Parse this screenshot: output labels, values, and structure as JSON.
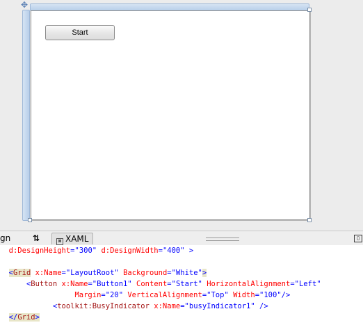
{
  "designer": {
    "start_button_label": "Start"
  },
  "tabs": {
    "design_label": "gn",
    "swap_glyph": "⇅",
    "xaml_label": "XAML"
  },
  "icons": {
    "move_handle": "move-icon",
    "swap": "swap-panes-icon",
    "xaml_tab": "xaml-icon",
    "collapse": "collapse-pane-icon"
  },
  "code": {
    "line1": {
      "a1": "d:DesignHeight",
      "eq1": "=",
      "v1": "\"300\"",
      "a2": "d:DesignWidth",
      "eq2": "=",
      "v2": "\"400\"",
      "close": ">"
    },
    "line3": {
      "open": "<",
      "elem": "Grid",
      "a1": "x:Name",
      "eq1": "=",
      "v1": "\"LayoutRoot\"",
      "a2": "Background",
      "eq2": "=",
      "v2": "\"White\"",
      "close": ">"
    },
    "line4": {
      "open": "<",
      "elem": "Button",
      "a1": "x:Name",
      "eq1": "=",
      "v1": "\"Button1\"",
      "a2": "Content",
      "eq2": "=",
      "v2": "\"Start\"",
      "a3": "HorizontalAlignment",
      "eq3": "=",
      "v3": "\"Left\""
    },
    "line5": {
      "a1": "Margin",
      "eq1": "=",
      "v1": "\"20\"",
      "a2": "VerticalAlignment",
      "eq2": "=",
      "v2": "\"Top\"",
      "a3": "Width",
      "eq3": "=",
      "v3": "\"100\"",
      "close": "/>"
    },
    "line6": {
      "open": "<",
      "elem": "toolkit:BusyIndicator",
      "a1": "x:Name",
      "eq1": "=",
      "v1": "\"busyIndicator1\"",
      "close": " />"
    },
    "line7": {
      "open": "</",
      "elem": "Grid",
      "close": ">"
    }
  }
}
